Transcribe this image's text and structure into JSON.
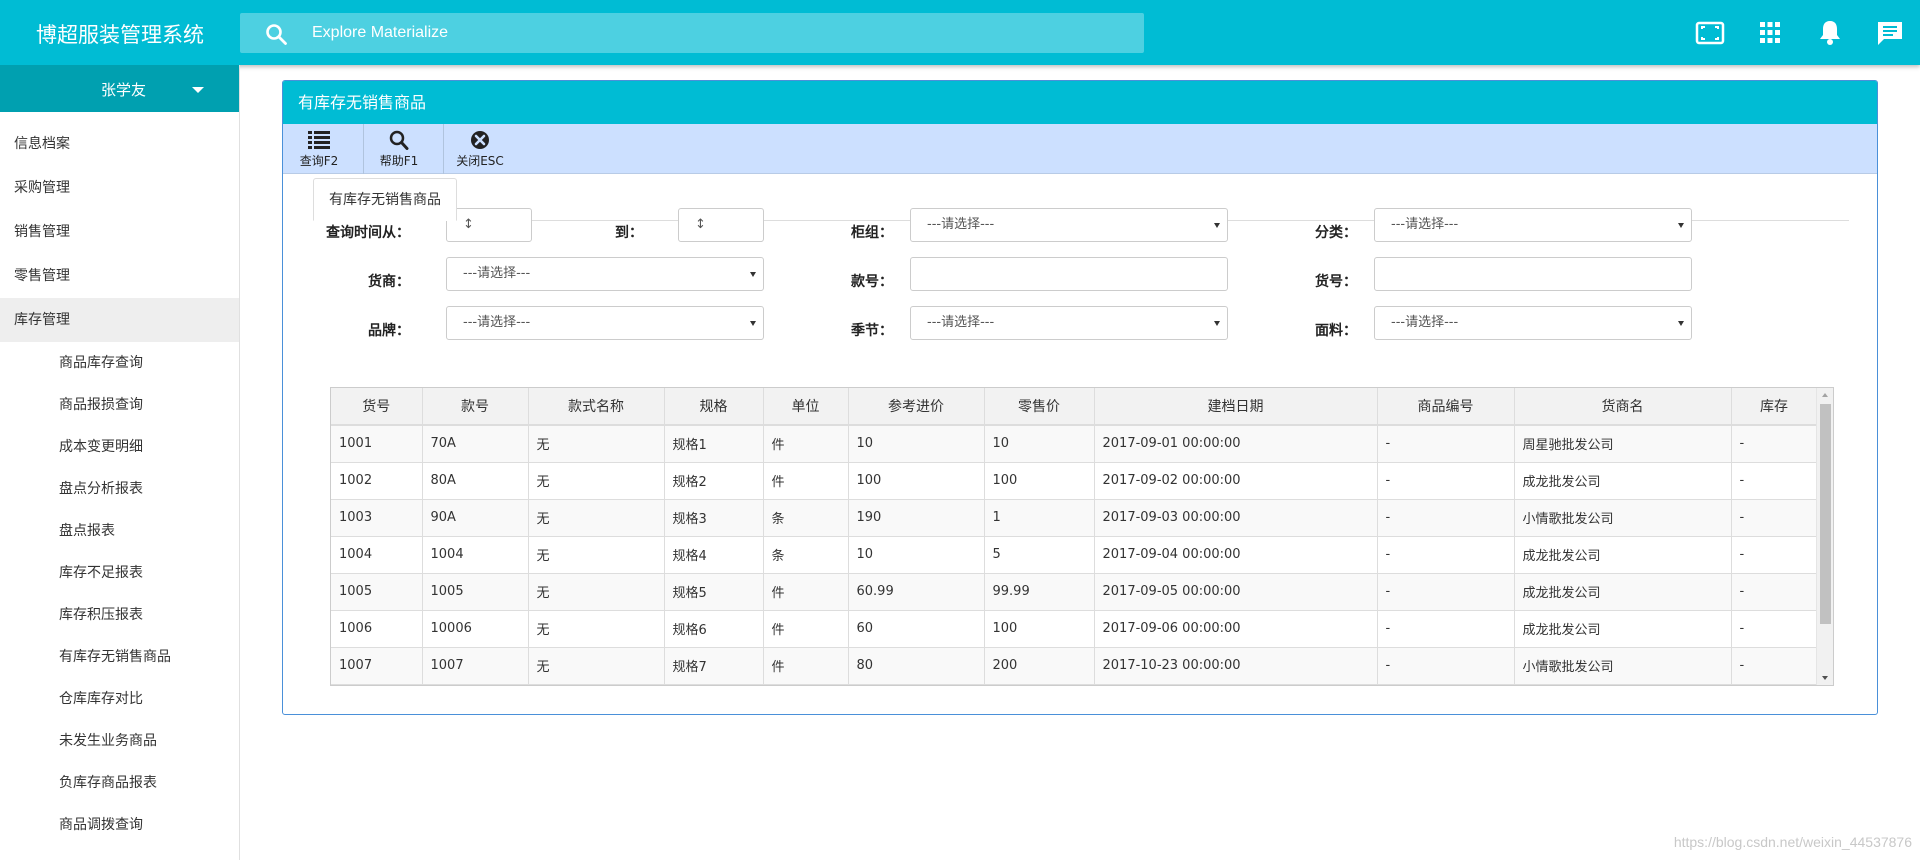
{
  "app": {
    "title": "博超服装管理系统"
  },
  "search": {
    "placeholder": "Explore Materialize"
  },
  "header_icons": [
    "fullscreen-icon",
    "apps-grid-icon",
    "notification-bell-icon",
    "chat-message-icon"
  ],
  "sidebar": {
    "user": "张学友",
    "menu": [
      "信息档案",
      "采购管理",
      "销售管理",
      "零售管理",
      "库存管理"
    ],
    "active_menu": "库存管理",
    "submenu": [
      "商品库存查询",
      "商品报损查询",
      "成本变更明细",
      "盘点分析报表",
      "盘点报表",
      "库存不足报表",
      "库存积压报表",
      "有库存无销售商品",
      "仓库库存对比",
      "未发生业务商品",
      "负库存商品报表",
      "商品调拨查询"
    ]
  },
  "panel": {
    "title": "有库存无销售商品"
  },
  "toolbar": {
    "query": "查询F2",
    "help": "帮助F1",
    "close": "关闭ESC"
  },
  "tab": {
    "label": "有库存无销售商品"
  },
  "filters": {
    "date_from_label": "查询时间从：",
    "date_from_value": "↕",
    "date_to_label": "到：",
    "date_to_value": "↕",
    "counter_label": "柜组：",
    "counter_value": "---请选择---",
    "category_label": "分类：",
    "category_value": "---请选择---",
    "supplier_label": "货商：",
    "supplier_value": "---请选择---",
    "style_label": "款号：",
    "style_value": "",
    "item_label": "货号：",
    "item_value": "",
    "brand_label": "品牌：",
    "brand_value": "---请选择---",
    "season_label": "季节：",
    "season_value": "---请选择---",
    "fabric_label": "面料：",
    "fabric_value": "---请选择---"
  },
  "table": {
    "columns": [
      "货号",
      "款号",
      "款式名称",
      "规格",
      "单位",
      "参考进价",
      "零售价",
      "建档日期",
      "商品编号",
      "货商名",
      "库存"
    ],
    "rows": [
      [
        "1001",
        "70A",
        "无",
        "规格1",
        "件",
        "10",
        "10",
        "2017-09-01 00:00:00",
        "-",
        "周星驰批发公司",
        "-"
      ],
      [
        "1002",
        "80A",
        "无",
        "规格2",
        "件",
        "100",
        "100",
        "2017-09-02 00:00:00",
        "-",
        "成龙批发公司",
        "-"
      ],
      [
        "1003",
        "90A",
        "无",
        "规格3",
        "条",
        "190",
        "1",
        "2017-09-03 00:00:00",
        "-",
        "小情歌批发公司",
        "-"
      ],
      [
        "1004",
        "1004",
        "无",
        "规格4",
        "条",
        "10",
        "5",
        "2017-09-04 00:00:00",
        "-",
        "成龙批发公司",
        "-"
      ],
      [
        "1005",
        "1005",
        "无",
        "规格5",
        "件",
        "60.99",
        "99.99",
        "2017-09-05 00:00:00",
        "-",
        "成龙批发公司",
        "-"
      ],
      [
        "1006",
        "10006",
        "无",
        "规格6",
        "件",
        "60",
        "100",
        "2017-09-06 00:00:00",
        "-",
        "成龙批发公司",
        "-"
      ],
      [
        "1007",
        "1007",
        "无",
        "规格7",
        "件",
        "80",
        "200",
        "2017-10-23 00:00:00",
        "-",
        "小情歌批发公司",
        "-"
      ]
    ]
  },
  "watermark": "https://blog.csdn.net/weixin_44537876"
}
